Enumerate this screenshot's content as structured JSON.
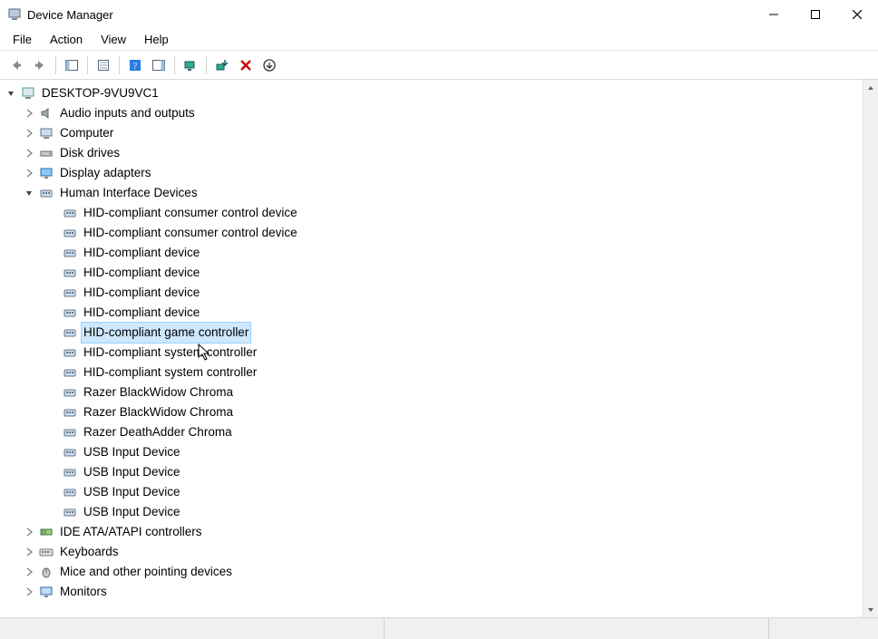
{
  "window": {
    "title": "Device Manager"
  },
  "menubar": {
    "items": [
      "File",
      "Action",
      "View",
      "Help"
    ]
  },
  "tree": {
    "root": "DESKTOP-9VU9VC1",
    "categories": [
      {
        "label": "Audio inputs and outputs",
        "expanded": false,
        "icon": "audio"
      },
      {
        "label": "Computer",
        "expanded": false,
        "icon": "computer"
      },
      {
        "label": "Disk drives",
        "expanded": false,
        "icon": "disk"
      },
      {
        "label": "Display adapters",
        "expanded": false,
        "icon": "display"
      },
      {
        "label": "Human Interface Devices",
        "expanded": true,
        "icon": "hid",
        "children": [
          "HID-compliant consumer control device",
          "HID-compliant consumer control device",
          "HID-compliant device",
          "HID-compliant device",
          "HID-compliant device",
          "HID-compliant device",
          "HID-compliant game controller",
          "HID-compliant system controller",
          "HID-compliant system controller",
          "Razer BlackWidow Chroma",
          "Razer BlackWidow Chroma",
          "Razer DeathAdder Chroma",
          "USB Input Device",
          "USB Input Device",
          "USB Input Device",
          "USB Input Device"
        ],
        "selected": "HID-compliant game controller"
      },
      {
        "label": "IDE ATA/ATAPI controllers",
        "expanded": false,
        "icon": "ide"
      },
      {
        "label": "Keyboards",
        "expanded": false,
        "icon": "keyboard"
      },
      {
        "label": "Mice and other pointing devices",
        "expanded": false,
        "icon": "mouse"
      },
      {
        "label": "Monitors",
        "expanded": false,
        "icon": "monitor"
      }
    ]
  }
}
